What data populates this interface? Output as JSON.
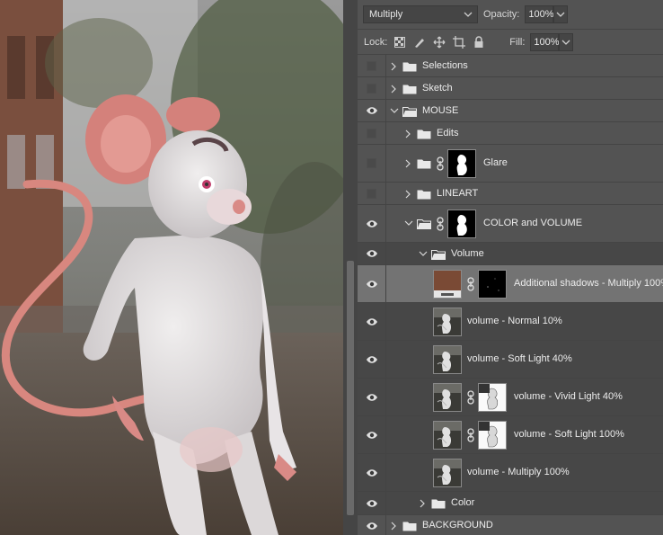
{
  "toolbar": {
    "blend_mode": "Multiply",
    "opacity_label": "Opacity:",
    "opacity_value": "100%",
    "lock_label": "Lock:",
    "fill_label": "Fill:",
    "fill_value": "100%"
  },
  "layers": [
    {
      "name": "Selections",
      "visible": false,
      "type": "group",
      "expanded": false
    },
    {
      "name": "Sketch",
      "visible": false,
      "type": "group",
      "expanded": false
    },
    {
      "name": "MOUSE",
      "visible": true,
      "type": "group",
      "expanded": true
    },
    {
      "name": "Edits",
      "visible": false,
      "type": "group",
      "expanded": false
    },
    {
      "name": "Glare",
      "visible": false,
      "type": "group-masked",
      "expanded": false
    },
    {
      "name": "LINEART",
      "visible": false,
      "type": "group",
      "expanded": false
    },
    {
      "name": "COLOR and VOLUME",
      "visible": true,
      "type": "group-masked",
      "expanded": true
    },
    {
      "name": "Volume",
      "visible": true,
      "type": "group",
      "expanded": true
    },
    {
      "name": "Additional shadows - Multiply 100%",
      "visible": true,
      "type": "layer-masked",
      "selected": true
    },
    {
      "name": "volume - Normal 10%",
      "visible": true,
      "type": "layer"
    },
    {
      "name": "volume - Soft Light 40%",
      "visible": true,
      "type": "layer"
    },
    {
      "name": "volume - Vivid Light 40%",
      "visible": true,
      "type": "layer-masked"
    },
    {
      "name": "volume - Soft Light 100%",
      "visible": true,
      "type": "layer-masked"
    },
    {
      "name": "volume - Multiply 100%",
      "visible": true,
      "type": "layer"
    },
    {
      "name": "Color",
      "visible": true,
      "type": "group",
      "expanded": false
    },
    {
      "name": "BACKGROUND",
      "visible": true,
      "type": "group",
      "expanded": false
    }
  ],
  "colors": {
    "panel_bg": "#535353",
    "selected_row": "#737373",
    "shadow_swatch": "#7a4a35"
  }
}
